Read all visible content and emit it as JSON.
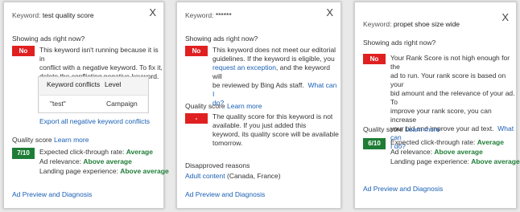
{
  "panel1": {
    "keyword_label": "Keyword:",
    "keyword": "test quality score",
    "close": "X",
    "showing_label": "Showing ads right now?",
    "badge": "No",
    "message_lines": [
      "This keyword isn't running because it is in",
      "conflict with a negative keyword. To fix it,",
      "delete the conflicting negative keyword."
    ],
    "table": {
      "headers": [
        "Keyword conflicts",
        "Level"
      ],
      "row": [
        "\"test\"",
        "Campaign"
      ]
    },
    "export_link": "Export all negative keyword conflicts",
    "quality_label": "Quality score",
    "learn_more": "Learn more",
    "score": "7/10",
    "ctr_label": "Expected click-through rate:",
    "ctr_value": "Average",
    "relevance_label": "Ad relevance:",
    "relevance_value": "Above average",
    "landing_label": "Landing page experience:",
    "landing_value": "Above average",
    "footer_link": "Ad Preview and Diagnosis"
  },
  "panel2": {
    "keyword_label": "Keyword:",
    "keyword": "******",
    "close": "X",
    "showing_label": "Showing ads right now?",
    "badge": "No",
    "line1": "This keyword does not meet our editorial",
    "line2": "guidelines. If the keyword is eligible, you",
    "line3_link": "request an exception",
    "line3_rest": ", and the keyword will",
    "line4_text": "be reviewed by Bing Ads staff.",
    "line4_link": "What can I",
    "line5_link": "do?",
    "quality_label": "Quality score",
    "learn_more": "Learn more",
    "score": "-",
    "quality_lines": [
      "The quality score for this keyword is not",
      "available. If you just added this",
      "keyword, its quality score will be available",
      "tomorrow."
    ],
    "disapproved_label": "Disapproved reasons",
    "adult_link": "Adult content",
    "adult_rest": " (Canada, France)",
    "footer_link": "Ad Preview and Diagnosis"
  },
  "panel3": {
    "keyword_label": "Keyword:",
    "keyword": "propet shoe size wide",
    "close": "X",
    "showing_label": "Showing ads right now?",
    "badge": "No",
    "message_lines": [
      "Your Rank Score is not high enough for the",
      "ad to run. Your rank score is based on your",
      "bid amount and the relevance of your ad. To",
      "improve your rank score, you can increase"
    ],
    "line5_text": "your bid and improve your ad text.",
    "line5_link": "What can",
    "line6_link": "I do?",
    "quality_label": "Quality score",
    "learn_more": "Learn more",
    "score": "6/10",
    "ctr_label": "Expected click-through rate:",
    "ctr_value": "Average",
    "relevance_label": "Ad relevance:",
    "relevance_value": "Above average",
    "landing_label": "Landing page experience:",
    "landing_value": "Above average",
    "footer_link": "Ad Preview and Diagnosis"
  }
}
